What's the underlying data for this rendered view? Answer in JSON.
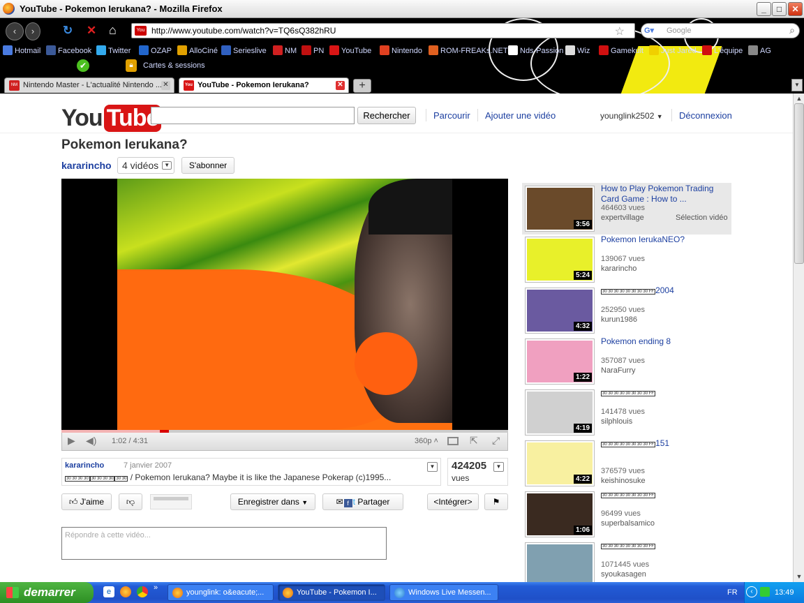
{
  "window": {
    "title": "YouTube - Pokemon Ierukana? - Mozilla Firefox"
  },
  "browser": {
    "url": "http://www.youtube.com/watch?v=TQ6sQ382hRU",
    "search_placeholder": "Google",
    "bookmarks": [
      {
        "label": "Hotmail",
        "color": "#4a7be0"
      },
      {
        "label": "Facebook",
        "color": "#3b5998"
      },
      {
        "label": "Twitter",
        "color": "#33aaee"
      },
      {
        "label": "OZAP",
        "color": "#2266cc"
      },
      {
        "label": "AlloCiné",
        "color": "#e0a000"
      },
      {
        "label": "Serieslive",
        "color": "#3060c0"
      },
      {
        "label": "NM",
        "color": "#d02020"
      },
      {
        "label": "PN",
        "color": "#c01010"
      },
      {
        "label": "YouTube",
        "color": "#d91515"
      },
      {
        "label": "Nintendo",
        "color": "#e04020"
      },
      {
        "label": "ROM-FREAKs.NET",
        "color": "#e06020"
      },
      {
        "label": "Nds-Passion",
        "color": "#ffffff"
      },
      {
        "label": "Wiz",
        "color": "#dddddd"
      },
      {
        "label": "Gamekult",
        "color": "#d01010"
      },
      {
        "label": "Just Jared",
        "color": "#f0d000"
      },
      {
        "label": "L'équipe",
        "color": "#d01010"
      },
      {
        "label": "AG",
        "color": "#888888"
      }
    ],
    "cartes": "Cartes & sessions",
    "tabs": [
      {
        "label": "Nintendo Master - L'actualité Nintendo ..."
      },
      {
        "label": "YouTube - Pokemon Ierukana?"
      }
    ]
  },
  "youtube": {
    "search_button": "Rechercher",
    "nav_browse": "Parcourir",
    "nav_upload": "Ajouter une vidéo",
    "user": "younglink2502",
    "logout": "Déconnexion",
    "video_title": "Pokemon Ierukana?",
    "channel": "kararincho",
    "video_count": "4 vidéos",
    "subscribe": "S'abonner",
    "time": "1:02 / 4:31",
    "quality": "360p",
    "progress_played": 0.02,
    "progress_buffered": 0.22,
    "info_channel": "kararincho",
    "info_date": "7 janvier 2007",
    "info_desc": "/ Pokemon Ierukana? Maybe it is like the Japanese Pokerap (c)1995...",
    "views": "424205",
    "views_label": "vues",
    "like": "J'aime",
    "save": "Enregistrer dans",
    "share": "Partager",
    "embed": "<Intégrer>",
    "comment_placeholder": "Répondre à cette vidéo..."
  },
  "related": [
    {
      "title": "How to Play Pokemon Trading Card Game : How to ...",
      "views": "464603 vues",
      "user": "expertvillage",
      "duration": "3:56",
      "extra": "Sélection vidéo",
      "bg": "#6a4a2a"
    },
    {
      "title": "Pokemon IerukaNEO?",
      "views": "139067 vues",
      "user": "kararincho",
      "duration": "5:24",
      "bg": "#e8f02a"
    },
    {
      "title": "2004",
      "views": "252950 vues",
      "user": "kurun1986",
      "duration": "4:32",
      "bg": "#6a5aa0"
    },
    {
      "title": "Pokemon ending 8",
      "views": "357087 vues",
      "user": "NaraFurry",
      "duration": "1:22",
      "bg": "#f0a0c0"
    },
    {
      "title": "",
      "views": "141478 vues",
      "user": "silphlouis",
      "duration": "4:19",
      "bg": "#d0d0d0"
    },
    {
      "title": "151",
      "views": "376579 vues",
      "user": "keishinosuke",
      "duration": "4:22",
      "bg": "#f8f0a0"
    },
    {
      "title": "",
      "views": "96499 vues",
      "user": "superbalsamico",
      "duration": "1:06",
      "bg": "#3a2a20"
    },
    {
      "title": "",
      "views": "1071445 vues",
      "user": "syoukasagen",
      "duration": "",
      "bg": "#80a0b0"
    }
  ],
  "taskbar": {
    "start": "demarrer",
    "tasks": [
      {
        "label": "younglink: o&eacute;..."
      },
      {
        "label": "YouTube - Pokemon I..."
      },
      {
        "label": "Windows Live Messen..."
      }
    ],
    "lang": "FR",
    "clock": "13:49"
  }
}
